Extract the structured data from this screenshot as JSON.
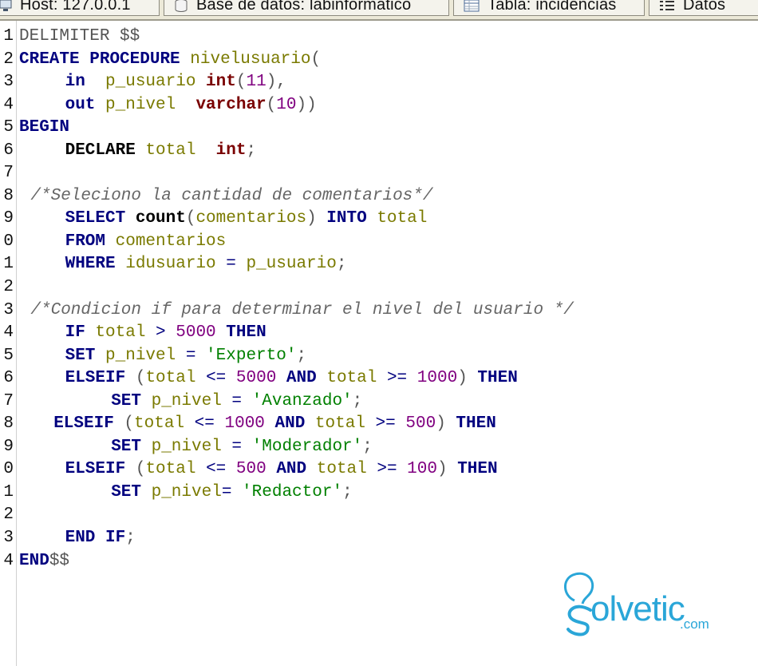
{
  "tabs": [
    {
      "label": "Host: 127.0.0.1",
      "icon": "host-icon"
    },
    {
      "label": "Base de datos: labinformatico",
      "icon": "database-icon"
    },
    {
      "label": "Tabla: incidencias",
      "icon": "table-icon"
    },
    {
      "label": "Datos",
      "icon": "data-list-icon"
    }
  ],
  "code": {
    "lines": [
      {
        "num": "1",
        "indent": 0,
        "tokens": [
          {
            "t": "DELIMITER $$",
            "c": "pl"
          }
        ]
      },
      {
        "num": "2",
        "indent": 0,
        "tokens": [
          {
            "t": "CREATE",
            "c": "kw"
          },
          {
            "t": " ",
            "c": "pl"
          },
          {
            "t": "PROCEDURE",
            "c": "kw"
          },
          {
            "t": " nivelusuario",
            "c": "id"
          },
          {
            "t": "(",
            "c": "pl"
          }
        ]
      },
      {
        "num": "3",
        "indent": 4,
        "tokens": [
          {
            "t": "in",
            "c": "kw"
          },
          {
            "t": "  p_usuario ",
            "c": "id"
          },
          {
            "t": "int",
            "c": "ty"
          },
          {
            "t": "(",
            "c": "pl"
          },
          {
            "t": "11",
            "c": "num"
          },
          {
            "t": "),",
            "c": "pl"
          }
        ]
      },
      {
        "num": "4",
        "indent": 4,
        "tokens": [
          {
            "t": "out",
            "c": "kw"
          },
          {
            "t": " p_nivel  ",
            "c": "id"
          },
          {
            "t": "varchar",
            "c": "ty"
          },
          {
            "t": "(",
            "c": "pl"
          },
          {
            "t": "10",
            "c": "num"
          },
          {
            "t": "))",
            "c": "pl"
          }
        ]
      },
      {
        "num": "5",
        "indent": 0,
        "tokens": [
          {
            "t": "BEGIN",
            "c": "kw"
          }
        ]
      },
      {
        "num": "6",
        "indent": 4,
        "tokens": [
          {
            "t": "DECLARE",
            "c": "fn"
          },
          {
            "t": " total  ",
            "c": "id"
          },
          {
            "t": "int",
            "c": "ty"
          },
          {
            "t": ";",
            "c": "pl"
          }
        ]
      },
      {
        "num": "7",
        "indent": 0,
        "tokens": []
      },
      {
        "num": "8",
        "indent": 1,
        "tokens": [
          {
            "t": "/*Seleciono la cantidad de comentarios*/",
            "c": "cm"
          }
        ]
      },
      {
        "num": "9",
        "indent": 4,
        "tokens": [
          {
            "t": "SELECT",
            "c": "kw"
          },
          {
            "t": " ",
            "c": "pl"
          },
          {
            "t": "count",
            "c": "fn"
          },
          {
            "t": "(",
            "c": "pl"
          },
          {
            "t": "comentarios",
            "c": "id"
          },
          {
            "t": ") ",
            "c": "pl"
          },
          {
            "t": "INTO",
            "c": "kw"
          },
          {
            "t": " total",
            "c": "id"
          }
        ]
      },
      {
        "num": "0",
        "indent": 4,
        "tokens": [
          {
            "t": "FROM",
            "c": "kw"
          },
          {
            "t": " comentarios",
            "c": "id"
          }
        ]
      },
      {
        "num": "1",
        "indent": 4,
        "tokens": [
          {
            "t": "WHERE",
            "c": "kw"
          },
          {
            "t": " idusuario ",
            "c": "id"
          },
          {
            "t": "=",
            "c": "op"
          },
          {
            "t": " p_usuario",
            "c": "id"
          },
          {
            "t": ";",
            "c": "pl"
          }
        ]
      },
      {
        "num": "2",
        "indent": 0,
        "tokens": []
      },
      {
        "num": "3",
        "indent": 1,
        "tokens": [
          {
            "t": "/*Condicion if para determinar el nivel del usuario */",
            "c": "cm"
          }
        ]
      },
      {
        "num": "4",
        "indent": 4,
        "tokens": [
          {
            "t": "IF",
            "c": "kw"
          },
          {
            "t": " total ",
            "c": "id"
          },
          {
            "t": ">",
            "c": "op"
          },
          {
            "t": " ",
            "c": "pl"
          },
          {
            "t": "5000",
            "c": "num"
          },
          {
            "t": " ",
            "c": "pl"
          },
          {
            "t": "THEN",
            "c": "kw"
          }
        ]
      },
      {
        "num": "5",
        "indent": 4,
        "tokens": [
          {
            "t": "SET",
            "c": "kw"
          },
          {
            "t": " p_nivel ",
            "c": "id"
          },
          {
            "t": "=",
            "c": "op"
          },
          {
            "t": " ",
            "c": "pl"
          },
          {
            "t": "'Experto'",
            "c": "str"
          },
          {
            "t": ";",
            "c": "pl"
          }
        ]
      },
      {
        "num": "6",
        "indent": 4,
        "tokens": [
          {
            "t": "ELSEIF",
            "c": "kw"
          },
          {
            "t": " (",
            "c": "pl"
          },
          {
            "t": "total ",
            "c": "id"
          },
          {
            "t": "<=",
            "c": "op"
          },
          {
            "t": " ",
            "c": "pl"
          },
          {
            "t": "5000",
            "c": "num"
          },
          {
            "t": " ",
            "c": "pl"
          },
          {
            "t": "AND",
            "c": "kw"
          },
          {
            "t": " total ",
            "c": "id"
          },
          {
            "t": ">=",
            "c": "op"
          },
          {
            "t": " ",
            "c": "pl"
          },
          {
            "t": "1000",
            "c": "num"
          },
          {
            "t": ") ",
            "c": "pl"
          },
          {
            "t": "THEN",
            "c": "kw"
          }
        ]
      },
      {
        "num": "7",
        "indent": 8,
        "tokens": [
          {
            "t": "SET",
            "c": "kw"
          },
          {
            "t": " p_nivel ",
            "c": "id"
          },
          {
            "t": "=",
            "c": "op"
          },
          {
            "t": " ",
            "c": "pl"
          },
          {
            "t": "'Avanzado'",
            "c": "str"
          },
          {
            "t": ";",
            "c": "pl"
          }
        ]
      },
      {
        "num": "8",
        "indent": 3,
        "tokens": [
          {
            "t": "ELSEIF",
            "c": "kw"
          },
          {
            "t": " (",
            "c": "pl"
          },
          {
            "t": "total ",
            "c": "id"
          },
          {
            "t": "<=",
            "c": "op"
          },
          {
            "t": " ",
            "c": "pl"
          },
          {
            "t": "1000",
            "c": "num"
          },
          {
            "t": " ",
            "c": "pl"
          },
          {
            "t": "AND",
            "c": "kw"
          },
          {
            "t": " total ",
            "c": "id"
          },
          {
            "t": ">=",
            "c": "op"
          },
          {
            "t": " ",
            "c": "pl"
          },
          {
            "t": "500",
            "c": "num"
          },
          {
            "t": ") ",
            "c": "pl"
          },
          {
            "t": "THEN",
            "c": "kw"
          }
        ]
      },
      {
        "num": "9",
        "indent": 8,
        "tokens": [
          {
            "t": "SET",
            "c": "kw"
          },
          {
            "t": " p_nivel ",
            "c": "id"
          },
          {
            "t": "=",
            "c": "op"
          },
          {
            "t": " ",
            "c": "pl"
          },
          {
            "t": "'Moderador'",
            "c": "str"
          },
          {
            "t": ";",
            "c": "pl"
          }
        ]
      },
      {
        "num": "0",
        "indent": 4,
        "tokens": [
          {
            "t": "ELSEIF",
            "c": "kw"
          },
          {
            "t": " (",
            "c": "pl"
          },
          {
            "t": "total ",
            "c": "id"
          },
          {
            "t": "<=",
            "c": "op"
          },
          {
            "t": " ",
            "c": "pl"
          },
          {
            "t": "500",
            "c": "num"
          },
          {
            "t": " ",
            "c": "pl"
          },
          {
            "t": "AND",
            "c": "kw"
          },
          {
            "t": " total ",
            "c": "id"
          },
          {
            "t": ">=",
            "c": "op"
          },
          {
            "t": " ",
            "c": "pl"
          },
          {
            "t": "100",
            "c": "num"
          },
          {
            "t": ") ",
            "c": "pl"
          },
          {
            "t": "THEN",
            "c": "kw"
          }
        ]
      },
      {
        "num": "1",
        "indent": 8,
        "tokens": [
          {
            "t": "SET",
            "c": "kw"
          },
          {
            "t": " p_nivel",
            "c": "id"
          },
          {
            "t": "=",
            "c": "op"
          },
          {
            "t": " ",
            "c": "pl"
          },
          {
            "t": "'Redactor'",
            "c": "str"
          },
          {
            "t": ";",
            "c": "pl"
          }
        ]
      },
      {
        "num": "2",
        "indent": 0,
        "tokens": []
      },
      {
        "num": "3",
        "indent": 4,
        "tokens": [
          {
            "t": "END",
            "c": "kw"
          },
          {
            "t": " ",
            "c": "pl"
          },
          {
            "t": "IF",
            "c": "kw"
          },
          {
            "t": ";",
            "c": "pl"
          }
        ]
      },
      {
        "num": "4",
        "indent": 0,
        "tokens": [
          {
            "t": "END",
            "c": "kw"
          },
          {
            "t": "$$",
            "c": "pl"
          }
        ]
      }
    ]
  },
  "watermark": {
    "brand": "olvetic",
    "domain": ".com",
    "color": "#2aa6d8"
  }
}
